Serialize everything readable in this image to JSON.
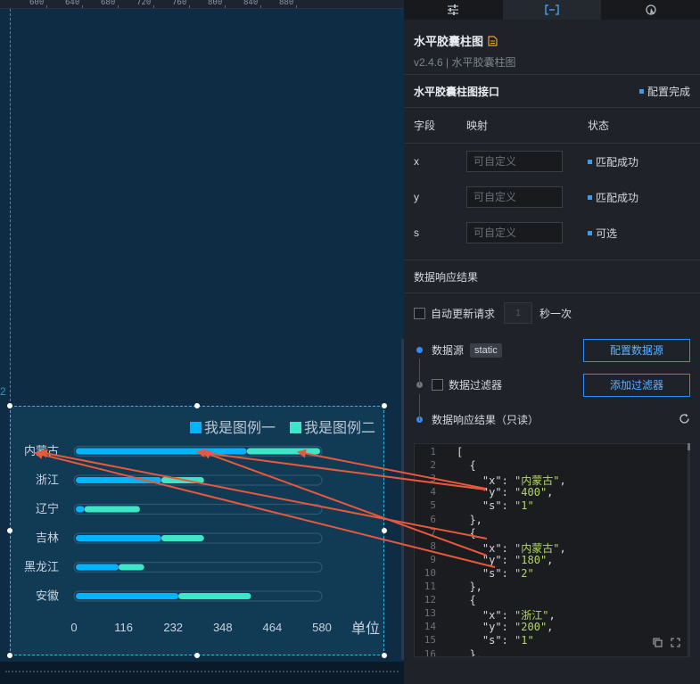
{
  "ruler": {
    "ticks": [
      "600",
      "640",
      "680",
      "720",
      "760",
      "800",
      "840",
      "880"
    ]
  },
  "guide_label": "2",
  "chart_data": {
    "type": "bar",
    "orientation": "horizontal",
    "stacked": true,
    "categories": [
      "内蒙古",
      "浙江",
      "辽宁",
      "吉林",
      "黑龙江",
      "安徽"
    ],
    "series": [
      {
        "name": "我是图例一",
        "color": "#00b4ff",
        "values": [
          400,
          200,
          20,
          200,
          100,
          240
        ]
      },
      {
        "name": "我是图例二",
        "color": "#3ee6c8",
        "values": [
          180,
          100,
          130,
          100,
          60,
          170
        ]
      }
    ],
    "x_ticks": [
      "0",
      "116",
      "232",
      "348",
      "464",
      "580"
    ],
    "xlim": [
      0,
      580
    ],
    "unit_label": "单位",
    "legend_position": "top-right",
    "grid": false
  },
  "panel": {
    "tabs": [
      {
        "name": "style",
        "icon": "sliders-icon"
      },
      {
        "name": "data",
        "icon": "data-brackets-icon"
      },
      {
        "name": "interaction",
        "icon": "interaction-icon"
      }
    ],
    "title": "水平胶囊柱图",
    "version": "v2.4.6 | 水平胶囊柱图",
    "interface": {
      "title": "水平胶囊柱图接口",
      "status": "配置完成"
    },
    "fields_header": {
      "field": "字段",
      "mapping": "映射",
      "status": "状态"
    },
    "fields": [
      {
        "name": "x",
        "placeholder": "可自定义",
        "status": "匹配成功"
      },
      {
        "name": "y",
        "placeholder": "可自定义",
        "status": "匹配成功"
      },
      {
        "name": "s",
        "placeholder": "可自定义",
        "status": "可选"
      }
    ],
    "response_title": "数据响应结果",
    "auto_update": {
      "label": "自动更新请求",
      "interval": "1",
      "unit": "秒一次"
    },
    "steps": {
      "source_label": "数据源",
      "source_tag": "static",
      "config_source_button": "配置数据源",
      "filter_label": "数据过滤器",
      "add_filter_button": "添加过滤器",
      "result_label": "数据响应结果（只读）"
    },
    "code": [
      "[",
      "  {",
      "    \"x\": \"内蒙古\",",
      "    \"y\": \"400\",",
      "    \"s\": \"1\"",
      "  },",
      "  {",
      "    \"x\": \"内蒙古\",",
      "    \"y\": \"180\",",
      "    \"s\": \"2\"",
      "  },",
      "  {",
      "    \"x\": \"浙江\",",
      "    \"y\": \"200\",",
      "    \"s\": \"1\"",
      "  },"
    ],
    "line_numbers": [
      "1",
      "2",
      "3",
      "4",
      "5",
      "6",
      "7",
      "8",
      "9",
      "10",
      "11",
      "12",
      "13",
      "14",
      "15",
      "16"
    ]
  },
  "colors": {
    "accent": "#2ea0ff",
    "annotation": "#e8583a",
    "bar_primary": "#00b4ff",
    "bar_secondary": "#3ee6c8"
  }
}
